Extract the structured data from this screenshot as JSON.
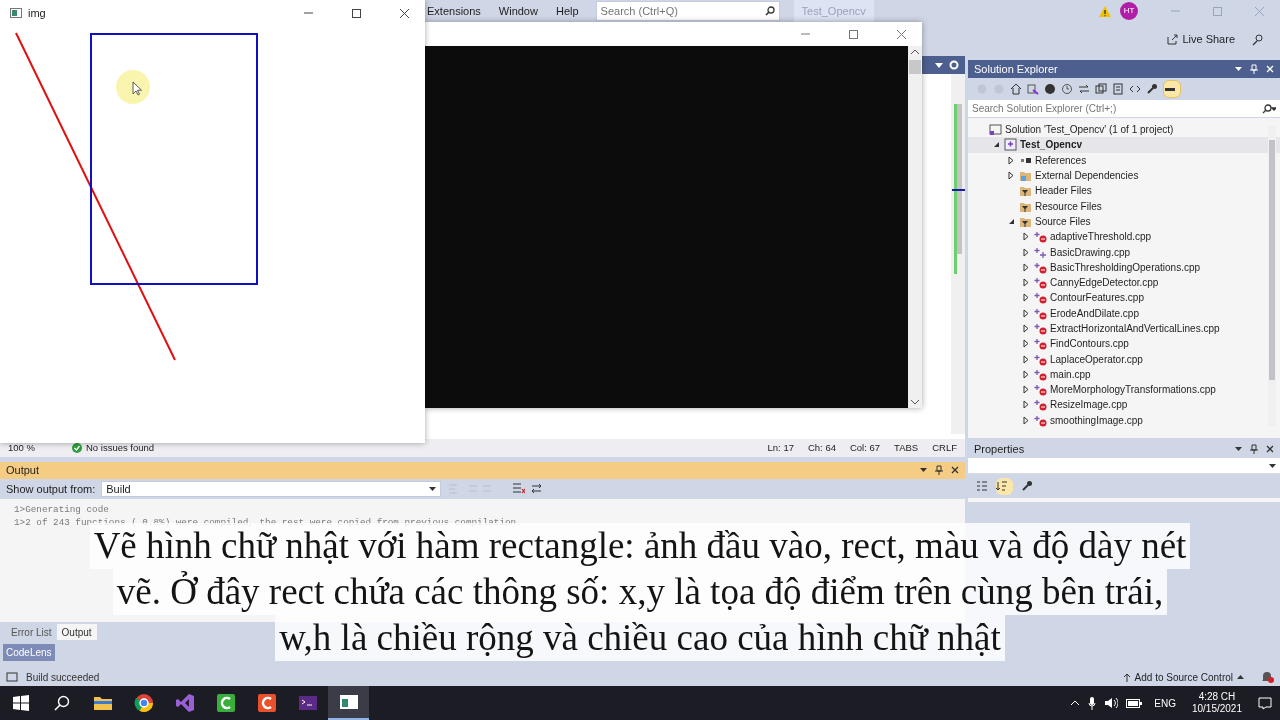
{
  "vs_window": {
    "menu": [
      {
        "label": "Extensions"
      },
      {
        "label": "Window"
      },
      {
        "label": "Help"
      }
    ],
    "search": {
      "placeholder": "Search (Ctrl+Q)"
    },
    "solution_tab": "Test_Opencv",
    "user_initials": "HT",
    "live_share": "Live Share"
  },
  "img_window": {
    "title": "img"
  },
  "editor_status": {
    "zoom": "100 %",
    "issues": "No issues found",
    "items": [
      "Ln: 17",
      "Ch: 64",
      "Col: 67",
      "TABS",
      "CRLF"
    ]
  },
  "output": {
    "title": "Output",
    "show_from_label": "Show output from:",
    "source": "Build",
    "lines": [
      "1>Generating code",
      "1>2 of 243 functions ( 0.8%) were compiled, the rest were copied from previous compilation."
    ]
  },
  "bottom_tabs": [
    {
      "label": "Error List",
      "selected": false
    },
    {
      "label": "Output",
      "selected": true
    }
  ],
  "codelens": "CodeLens",
  "solution_explorer": {
    "title": "Solution Explorer",
    "search": {
      "placeholder": "Search Solution Explorer (Ctrl+;)"
    },
    "tree": [
      {
        "label": "Solution 'Test_Opencv' (1 of 1 project)",
        "kind": "solution",
        "selected": false,
        "children": [
          {
            "label": "Test_Opencv",
            "kind": "project",
            "expanded": true,
            "selected": true,
            "children": [
              {
                "label": "References",
                "kind": "references",
                "expanded": false,
                "selected": false
              },
              {
                "label": "External Dependencies",
                "kind": "dependencies",
                "expanded": false,
                "selected": false
              },
              {
                "label": "Header Files",
                "kind": "filter",
                "selected": false
              },
              {
                "label": "Resource Files",
                "kind": "filter",
                "selected": false
              },
              {
                "label": "Source Files",
                "kind": "filter",
                "expanded": true,
                "selected": false,
                "children": [
                  {
                    "label": "adaptiveThreshold.cpp",
                    "kind": "file",
                    "excluded": true,
                    "expanded": false,
                    "selected": false
                  },
                  {
                    "label": "BasicDrawing.cpp",
                    "kind": "file",
                    "excluded": false,
                    "expanded": false,
                    "selected": false
                  },
                  {
                    "label": "BasicThresholdingOperations.cpp",
                    "kind": "file",
                    "excluded": true,
                    "expanded": false,
                    "selected": false
                  },
                  {
                    "label": "CannyEdgeDetector.cpp",
                    "kind": "file",
                    "excluded": true,
                    "expanded": false,
                    "selected": false
                  },
                  {
                    "label": "ContourFeatures.cpp",
                    "kind": "file",
                    "excluded": true,
                    "expanded": false,
                    "selected": false
                  },
                  {
                    "label": "ErodeAndDilate.cpp",
                    "kind": "file",
                    "excluded": true,
                    "expanded": false,
                    "selected": false
                  },
                  {
                    "label": "ExtractHorizontalAndVerticalLines.cpp",
                    "kind": "file",
                    "excluded": true,
                    "expanded": false,
                    "selected": false
                  },
                  {
                    "label": "FindContours.cpp",
                    "kind": "file",
                    "excluded": true,
                    "expanded": false,
                    "selected": false
                  },
                  {
                    "label": "LaplaceOperator.cpp",
                    "kind": "file",
                    "excluded": true,
                    "expanded": false,
                    "selected": false
                  },
                  {
                    "label": "main.cpp",
                    "kind": "file",
                    "excluded": true,
                    "expanded": false,
                    "selected": false
                  },
                  {
                    "label": "MoreMorphologyTransformations.cpp",
                    "kind": "file",
                    "excluded": true,
                    "expanded": false,
                    "selected": false
                  },
                  {
                    "label": "ResizeImage.cpp",
                    "kind": "file",
                    "excluded": true,
                    "expanded": false,
                    "selected": false
                  },
                  {
                    "label": "smoothingImage.cpp",
                    "kind": "file",
                    "excluded": true,
                    "expanded": false,
                    "selected": false
                  }
                ]
              }
            ]
          }
        ]
      }
    ]
  },
  "properties": {
    "title": "Properties"
  },
  "status_bar": {
    "message": "Build succeeded",
    "source_control": "Add to Source Control"
  },
  "taskbar": {
    "apps": [
      {
        "kind": "folder",
        "active": false
      },
      {
        "kind": "browser",
        "active": false
      },
      {
        "kind": "ide",
        "active": false
      },
      {
        "kind": "green-app",
        "active": false
      },
      {
        "kind": "orange-app",
        "active": false
      },
      {
        "kind": "terminal",
        "active": false
      },
      {
        "kind": "window",
        "active": true
      }
    ],
    "language": "ENG",
    "time": "4:28 CH",
    "date": "10/15/2021"
  },
  "caption": {
    "lines": [
      "Vẽ hình chữ nhật với hàm rectangle: ảnh đầu vào, rect, màu và độ dày nét",
      "vẽ. Ở đây rect chứa các thông số: x,y là tọa độ điểm trên cùng bên trái,",
      "w,h là chiều rộng và chiều cao của hình chữ nhật"
    ]
  }
}
